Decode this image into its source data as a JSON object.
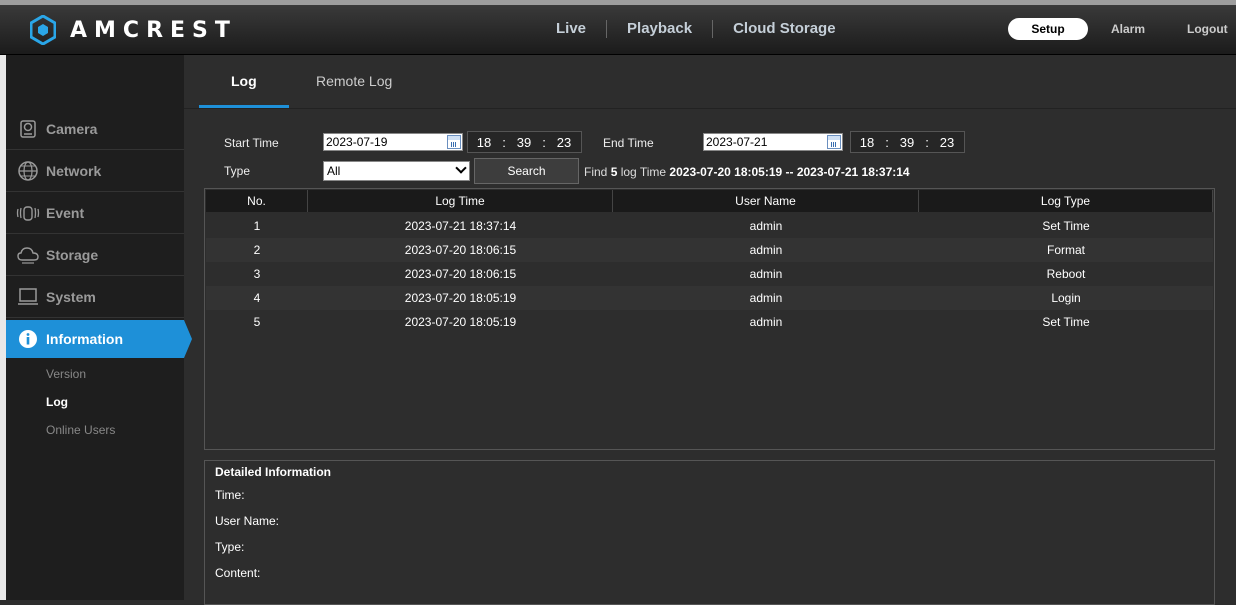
{
  "brand": {
    "name": "AMCREST"
  },
  "nav": {
    "live": "Live",
    "playback": "Playback",
    "cloud": "Cloud Storage"
  },
  "top_right": {
    "setup": "Setup",
    "alarm": "Alarm",
    "logout": "Logout"
  },
  "sidebar": {
    "items": [
      {
        "label": "Camera",
        "icon": "camera-icon"
      },
      {
        "label": "Network",
        "icon": "globe-icon"
      },
      {
        "label": "Event",
        "icon": "event-icon"
      },
      {
        "label": "Storage",
        "icon": "cloud-icon"
      },
      {
        "label": "System",
        "icon": "monitor-icon"
      },
      {
        "label": "Information",
        "icon": "info-icon"
      }
    ],
    "sub_items": [
      {
        "label": "Version"
      },
      {
        "label": "Log"
      },
      {
        "label": "Online Users"
      }
    ]
  },
  "tabs": {
    "log": "Log",
    "remote_log": "Remote Log"
  },
  "filters": {
    "start_label": "Start Time",
    "start_date": "2023-07-19",
    "start_h": "18",
    "start_m": "39",
    "start_s": "23",
    "end_label": "End Time",
    "end_date": "2023-07-21",
    "end_h": "18",
    "end_m": "39",
    "end_s": "23",
    "sep": ":",
    "type_label": "Type",
    "type_value": "All",
    "search": "Search"
  },
  "find": {
    "prefix": "Find",
    "count": "5",
    "middle": "log Time",
    "range": "2023-07-20 18:05:19 -- 2023-07-21 18:37:14"
  },
  "table": {
    "headers": [
      "No.",
      "Log Time",
      "User Name",
      "Log Type"
    ],
    "rows": [
      [
        "1",
        "2023-07-21 18:37:14",
        "admin",
        "Set Time"
      ],
      [
        "2",
        "2023-07-20 18:06:15",
        "admin",
        "Format"
      ],
      [
        "3",
        "2023-07-20 18:06:15",
        "admin",
        "Reboot"
      ],
      [
        "4",
        "2023-07-20 18:05:19",
        "admin",
        "Login"
      ],
      [
        "5",
        "2023-07-20 18:05:19",
        "admin",
        "Set Time"
      ]
    ]
  },
  "detail": {
    "title": "Detailed Information",
    "time": "Time:",
    "user": "User Name:",
    "type": "Type:",
    "content": "Content:"
  },
  "colors": {
    "accent": "#1e90d8"
  }
}
